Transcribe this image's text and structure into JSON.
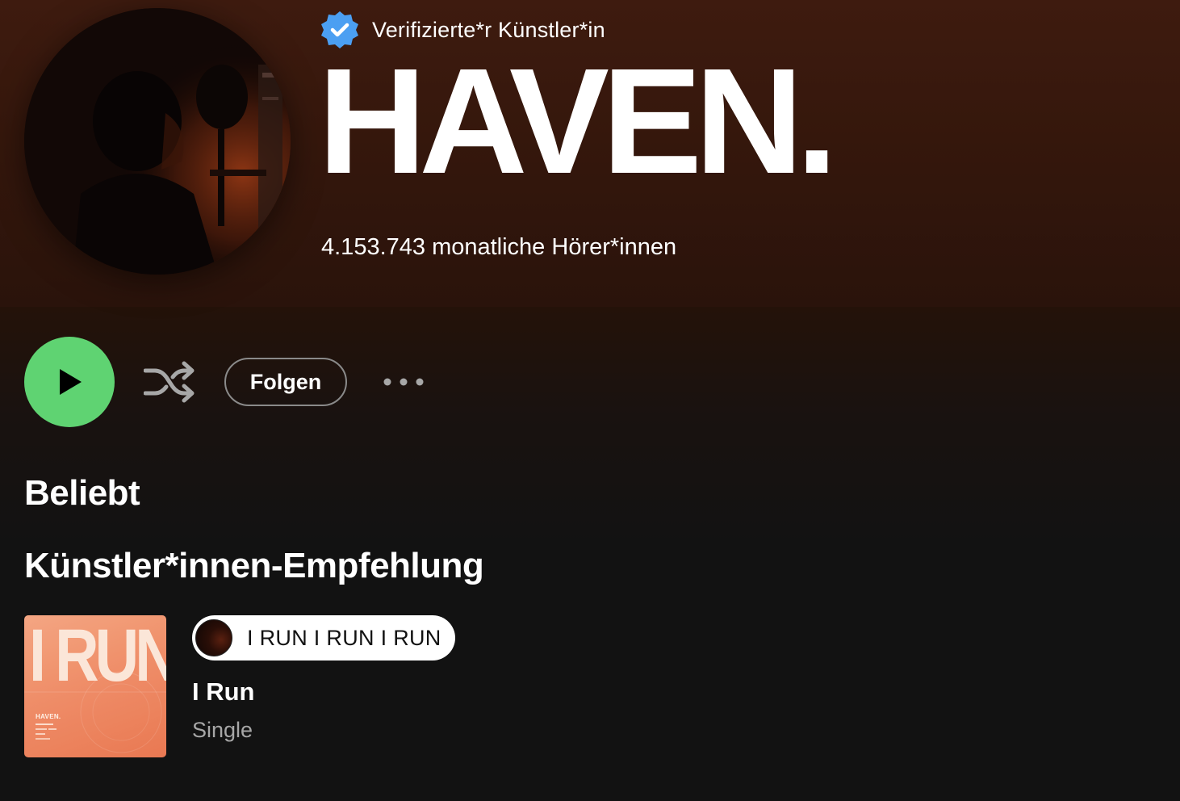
{
  "artist": {
    "verified_label": "Verifizierte*r Künstler*in",
    "name": "HAVEN.",
    "monthly_listeners": "4.153.743 monatliche Hörer*innen"
  },
  "actions": {
    "follow_label": "Folgen"
  },
  "sections": {
    "popular_title": "Beliebt",
    "artist_pick_title": "Künstler*innen-Empfehlung"
  },
  "artist_pick": {
    "pill_text": "I RUN I RUN I RUN",
    "title": "I Run",
    "type": "Single",
    "cover_title": "I RUN",
    "cover_artist": "HAVEN."
  },
  "colors": {
    "play_green": "#5fd372",
    "header_brown": "#3e1b0f",
    "background": "#121212",
    "verified_blue": "#4b9ff2",
    "cover_orange": "#ef8a63"
  },
  "icons": {
    "verified": "verified-badge-icon",
    "play": "play-icon",
    "shuffle": "shuffle-icon",
    "more": "more-options-icon"
  }
}
